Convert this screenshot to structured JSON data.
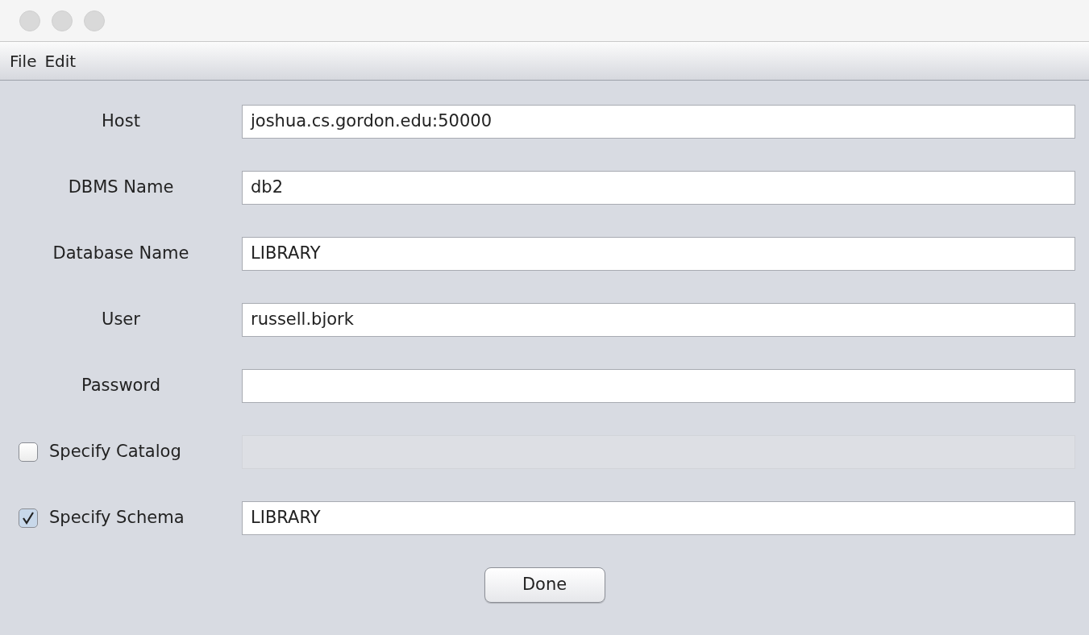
{
  "menu": [
    "File",
    "Edit"
  ],
  "fields": [
    {
      "kind": "label",
      "label": "Host",
      "value": "joshua.cs.gordon.edu:50000",
      "disabled": false
    },
    {
      "kind": "label",
      "label": "DBMS Name",
      "value": "db2",
      "disabled": false
    },
    {
      "kind": "label",
      "label": "Database Name",
      "value": "LIBRARY",
      "disabled": false
    },
    {
      "kind": "label",
      "label": "User",
      "value": "russell.bjork",
      "disabled": false
    },
    {
      "kind": "label",
      "label": "Password",
      "disabled": false
    },
    {
      "kind": "check",
      "label": "Specify Catalog",
      "checked": false,
      "disabled": true
    },
    {
      "kind": "check",
      "label": "Specify Schema",
      "checked": true,
      "value": "LIBRARY",
      "disabled": false
    }
  ],
  "button": "Done"
}
